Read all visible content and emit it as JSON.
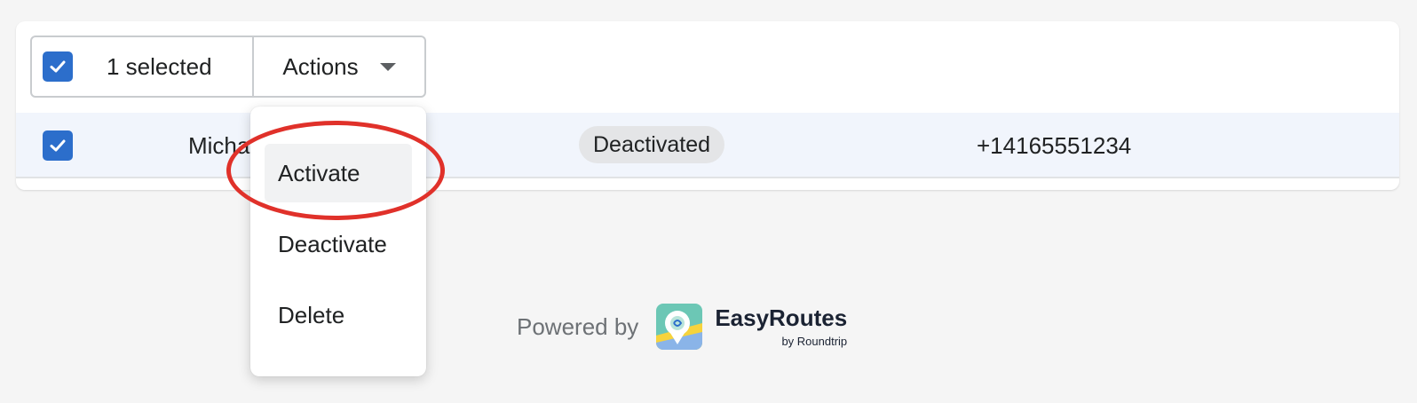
{
  "bulk_bar": {
    "select_all_checked": true,
    "selected_label": "1 selected",
    "actions_label": "Actions"
  },
  "table": {
    "rows": [
      {
        "checked": true,
        "name": "Micha",
        "status": "Deactivated",
        "phone": "+14165551234"
      }
    ]
  },
  "actions_menu": {
    "items": [
      {
        "label": "Activate",
        "highlighted": true
      },
      {
        "label": "Deactivate"
      },
      {
        "label": "Delete"
      }
    ]
  },
  "footer": {
    "powered_by": "Powered by",
    "brand_name": "EasyRoutes",
    "brand_sub": "by Roundtrip"
  },
  "colors": {
    "accent": "#2c6ecb",
    "selected_row": "#f1f5fc",
    "annotation": "#e0312a"
  },
  "icons": {
    "checkbox": "check-icon",
    "actions": "chevron-down-icon",
    "brand": "easyroutes-logo"
  }
}
